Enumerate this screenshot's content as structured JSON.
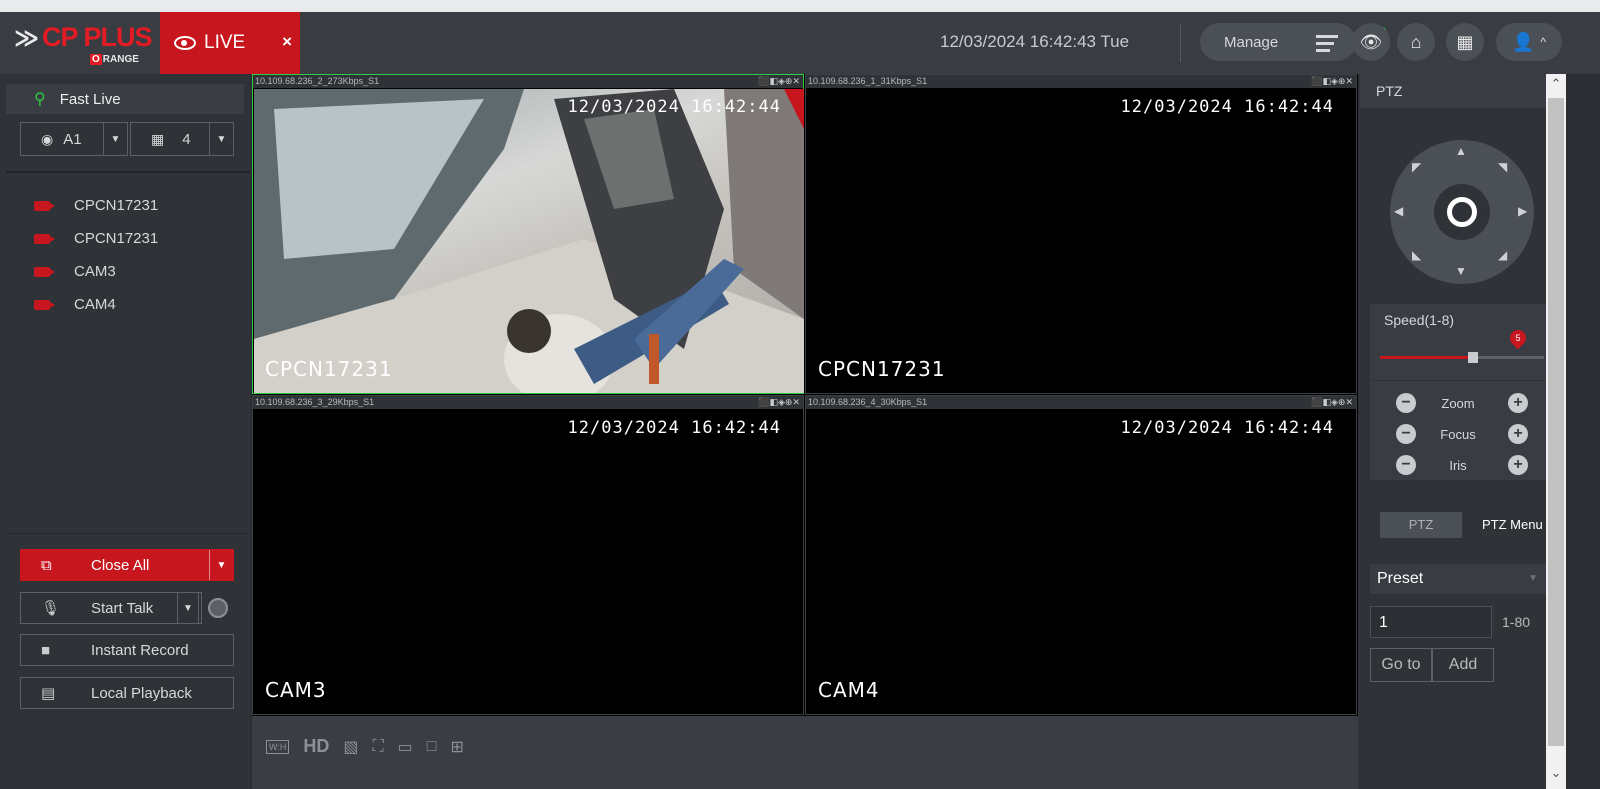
{
  "header": {
    "brand": "CP PLUS",
    "brand_sub": "RANGE",
    "brand_sub_mark": "O",
    "live_tab": "LIVE",
    "live_close": "×",
    "datetime": "12/03/2024 16:42:43 Tue",
    "manage_label": "Manage"
  },
  "sidebar": {
    "fast_live": "Fast Live",
    "account_select": "A1",
    "split_select": "4",
    "cameras": [
      {
        "name": "CPCN17231"
      },
      {
        "name": "CPCN17231"
      },
      {
        "name": "CAM3"
      },
      {
        "name": "CAM4"
      }
    ],
    "close_all": "Close All",
    "start_talk": "Start Talk",
    "instant_record": "Instant Record",
    "local_playback": "Local Playback"
  },
  "tiles": [
    {
      "caption": "10.109.68.236_2_273Kbps_S1",
      "timestamp": "12/03/2024 16:42:44",
      "name": "CPCN17231"
    },
    {
      "caption": "10.109.68.236_1_31Kbps_S1",
      "timestamp": "12/03/2024 16:42:44",
      "name": "CPCN17231"
    },
    {
      "caption": "10.109.68.236_3_29Kbps_S1",
      "timestamp": "12/03/2024 16:42:44",
      "name": "CAM3"
    },
    {
      "caption": "10.109.68.236_4_30Kbps_S1",
      "timestamp": "12/03/2024 16:42:44",
      "name": "CAM4"
    }
  ],
  "bottombar": {
    "wh_label": "W:H",
    "hd_label": "HD"
  },
  "ptz": {
    "title": "PTZ",
    "speed_label": "Speed(1-8)",
    "speed_value": "5",
    "speed_fraction": 0.57,
    "zoom": "Zoom",
    "focus": "Focus",
    "iris": "Iris",
    "tab_ptz": "PTZ",
    "tab_ptz_menu": "PTZ Menu",
    "preset_label": "Preset",
    "preset_value": "1",
    "preset_range": "1-80",
    "goto_label": "Go to",
    "add_label": "Add"
  },
  "colors": {
    "accent_red": "#c8161e",
    "active_green": "#2ecc40",
    "panel_dark": "#2f3237"
  }
}
